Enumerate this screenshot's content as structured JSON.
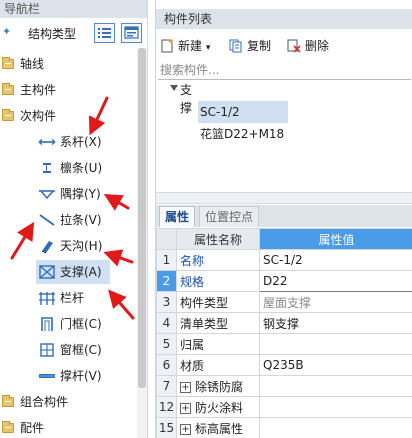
{
  "nav": {
    "title": "导航栏",
    "tool_label": "结构类型",
    "folders": [
      {
        "label": "轴线"
      },
      {
        "label": "主构件"
      },
      {
        "label": "次构件"
      }
    ],
    "sub_items": [
      {
        "label": "系杆(X)",
        "icon": "tie-rod-icon"
      },
      {
        "label": "檩条(U)",
        "icon": "purlin-icon"
      },
      {
        "label": "隅撑(Y)",
        "icon": "knee-brace-icon"
      },
      {
        "label": "拉条(V)",
        "icon": "sag-rod-icon"
      },
      {
        "label": "天沟(H)",
        "icon": "gutter-icon"
      },
      {
        "label": "支撑(A)",
        "icon": "bracing-icon"
      },
      {
        "label": "栏杆",
        "icon": "railing-icon"
      },
      {
        "label": "门框(C)",
        "icon": "door-frame-icon"
      },
      {
        "label": "窗框(C)",
        "icon": "window-frame-icon"
      },
      {
        "label": "撑杆(V)",
        "icon": "strut-icon"
      }
    ],
    "folders_bottom": [
      {
        "label": "组合构件"
      },
      {
        "label": "配件"
      }
    ],
    "selected_sub": "支撑(A)"
  },
  "component_list": {
    "title": "构件列表",
    "toolbar": {
      "new": "新建",
      "copy": "复制",
      "delete": "删除"
    },
    "search_placeholder": "搜索构件...",
    "root": "支撑",
    "items": [
      "SC-1/2",
      "花篮D22+M18"
    ]
  },
  "tabs": [
    {
      "label": "属性",
      "active": true
    },
    {
      "label": "位置控点",
      "active": false
    }
  ],
  "properties": {
    "header_name": "属性名称",
    "header_value": "属性值",
    "rows": [
      {
        "num": "1",
        "name": "名称",
        "value": "SC-1/2",
        "name_style": "blue",
        "value_style": ""
      },
      {
        "num": "2",
        "name": "规格",
        "value": "D22",
        "name_style": "blue",
        "value_style": ""
      },
      {
        "num": "3",
        "name": "构件类型",
        "value": "屋面支撑",
        "name_style": "",
        "value_style": "gray"
      },
      {
        "num": "4",
        "name": "清单类型",
        "value": "钢支撑",
        "name_style": "",
        "value_style": ""
      },
      {
        "num": "5",
        "name": "归属",
        "value": "",
        "name_style": "",
        "value_style": ""
      },
      {
        "num": "6",
        "name": "材质",
        "value": "Q235B",
        "name_style": "",
        "value_style": ""
      },
      {
        "num": "7",
        "name": "除锈防腐",
        "value": "",
        "name_style": "",
        "value_style": "",
        "expand": true
      },
      {
        "num": "12",
        "name": "防火涂料",
        "value": "",
        "name_style": "",
        "value_style": "",
        "expand": true
      },
      {
        "num": "15",
        "name": "标高属性",
        "value": "",
        "name_style": "",
        "value_style": "",
        "expand": true
      }
    ]
  },
  "colors": {
    "accent": "#4a9be8",
    "selection": "#cfe0f3",
    "annotation": "#e01a1a"
  }
}
